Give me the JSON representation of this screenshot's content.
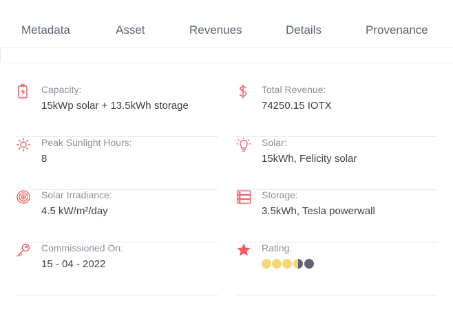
{
  "tabs": [
    {
      "label": "Metadata"
    },
    {
      "label": "Asset"
    },
    {
      "label": "Revenues"
    },
    {
      "label": "Details"
    },
    {
      "label": "Provenance"
    }
  ],
  "details": {
    "capacity": {
      "label": "Capacity:",
      "value": "15kWp solar + 13.5kWh storage",
      "icon": "battery-charging-icon"
    },
    "total_revenue": {
      "label": "Total Revenue:",
      "value": "74250.15 IOTX",
      "icon": "dollar-icon"
    },
    "peak_sunlight": {
      "label": "Peak Sunlight Hours:",
      "value": "8",
      "icon": "sun-icon"
    },
    "solar": {
      "label": "Solar:",
      "value": "15kWh, Felicity solar",
      "icon": "lightbulb-icon"
    },
    "irradiance": {
      "label": "Solar Irradiance:",
      "value": "4.5 kW/m²/day",
      "icon": "target-icon"
    },
    "storage": {
      "label": "Storage:",
      "value": "3.5kWh, Tesla powerwall",
      "icon": "server-icon"
    },
    "commissioned": {
      "label": "Commissioned On:",
      "value": "15 - 04 - 2022",
      "icon": "key-icon"
    },
    "rating": {
      "label": "Rating:",
      "value": 3.5,
      "max": 5,
      "icon": "star-icon"
    }
  },
  "colors": {
    "accent": "#f2595d",
    "star_filled": "#f5d77a",
    "star_empty": "#5f6672",
    "tab_text": "#5b6270",
    "label": "#8a8f9b",
    "value": "#3a3f48"
  }
}
